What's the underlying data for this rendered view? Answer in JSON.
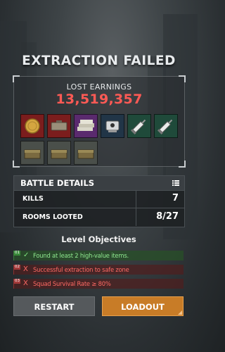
{
  "header": {
    "title": "EXTRACTION FAILED"
  },
  "earnings": {
    "label": "LOST EARNINGS",
    "value": "13,519,357"
  },
  "items": [
    {
      "name": "gold-coin",
      "color": "#7b1d1d"
    },
    {
      "name": "gun-case",
      "color": "#7b1d1d"
    },
    {
      "name": "cash-stack",
      "color": "#5a2a6e"
    },
    {
      "name": "tech-device",
      "color": "#213547"
    },
    {
      "name": "syringe",
      "color": "#1f4a3a"
    },
    {
      "name": "syringe",
      "color": "#1f4a3a"
    },
    {
      "name": "ammo-box",
      "color": "#4a4f4a"
    },
    {
      "name": "ammo-box",
      "color": "#4a4f4a"
    },
    {
      "name": "ammo-box",
      "color": "#4a4f4a"
    }
  ],
  "battle": {
    "title": "BATTLE DETAILS",
    "rows": [
      {
        "label": "KILLS",
        "value": "7"
      },
      {
        "label": "ROOMS LOOTED",
        "value": "8/27"
      }
    ]
  },
  "objectives": {
    "title": "Level Objectives",
    "items": [
      {
        "num": "01",
        "icon": "✓",
        "text": "Found at least 2 high-value items.",
        "status": "success"
      },
      {
        "num": "02",
        "icon": "X",
        "text": "Successful extraction to safe zone",
        "status": "fail"
      },
      {
        "num": "03",
        "icon": "X",
        "text": "Squad Survival Rate ≥ 80%",
        "status": "fail"
      }
    ]
  },
  "buttons": {
    "restart": "RESTART",
    "loadout": "LOADOUT"
  },
  "colors": {
    "accent": "#c87c27",
    "danger": "#ff5a55",
    "success": "#6fd36f"
  }
}
